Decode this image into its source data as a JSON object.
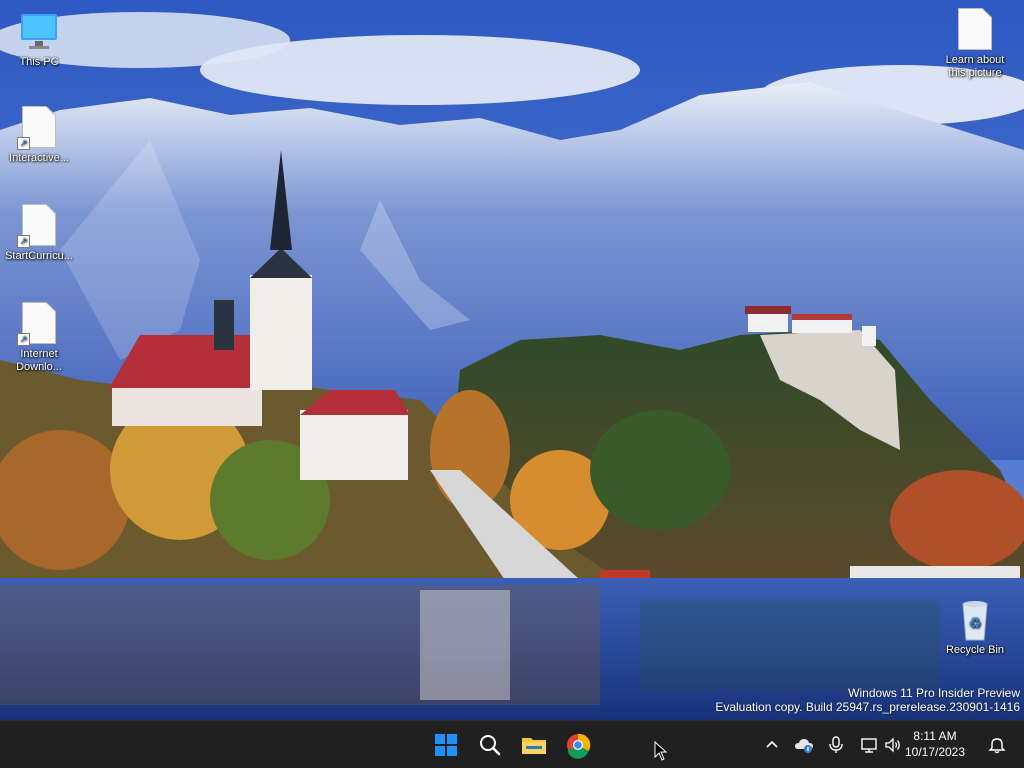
{
  "desktop": {
    "icons": [
      {
        "label": "This PC",
        "icon": "monitor-icon"
      },
      {
        "label": "Interactive...",
        "icon": "file-shortcut-icon"
      },
      {
        "label": "StartCurricu...",
        "icon": "file-shortcut-icon"
      },
      {
        "label": "Internet\nDownlo...",
        "icon": "file-shortcut-icon"
      },
      {
        "label": "Learn about\nthis picture",
        "icon": "file-icon"
      },
      {
        "label": "Recycle Bin",
        "icon": "recycle-bin-icon"
      }
    ],
    "watermark": {
      "line1": "Windows 11 Pro Insider Preview",
      "line2": "Evaluation copy. Build 25947.rs_prerelease.230901-1416"
    }
  },
  "taskbar": {
    "pinned": [
      {
        "name": "start",
        "icon": "windows-logo-icon"
      },
      {
        "name": "search",
        "icon": "search-icon"
      },
      {
        "name": "file-explorer",
        "icon": "folder-icon"
      },
      {
        "name": "chrome",
        "icon": "chrome-icon"
      }
    ],
    "tray": {
      "icons": [
        "chevron-up-icon",
        "onedrive-icon",
        "microphone-icon",
        "network-icon",
        "volume-icon"
      ],
      "time": "8:11 AM",
      "date": "10/17/2023",
      "notification_icon": "bell-icon"
    }
  },
  "colors": {
    "taskbar_bg": "#202020",
    "windows_blue": "#1e90ff",
    "folder_yellow": "#f5c542"
  }
}
